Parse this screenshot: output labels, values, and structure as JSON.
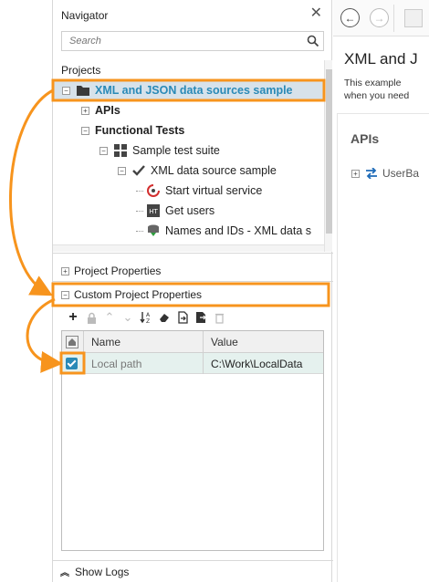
{
  "navigator": {
    "title": "Navigator",
    "search_placeholder": "Search",
    "projects_label": "Projects",
    "tree": [
      {
        "label": "XML and JSON data sources sample",
        "icon": "folder-icon",
        "expander": "−"
      },
      {
        "label": "APIs",
        "icon": "",
        "expander": "+"
      },
      {
        "label": "Functional Tests",
        "icon": "",
        "expander": "−"
      },
      {
        "label": "Sample test suite",
        "icon": "grid-icon",
        "expander": "−"
      },
      {
        "label": "XML data source sample",
        "icon": "checkmark-icon",
        "expander": "−"
      },
      {
        "label": "Start virtual service",
        "icon": "virtual-service-icon",
        "expander": ""
      },
      {
        "label": "Get users",
        "icon": "request-icon",
        "expander": ""
      },
      {
        "label": "Names and IDs - XML data s",
        "icon": "data-source-icon",
        "expander": ""
      }
    ],
    "project_properties_label": "Project Properties",
    "custom_properties_label": "Custom Project Properties",
    "grid": {
      "columns": [
        "Name",
        "Value"
      ],
      "rows": [
        {
          "checked": true,
          "name": "Local path",
          "value": "C:\\Work\\LocalData"
        }
      ]
    },
    "show_logs_label": "Show Logs"
  },
  "right_panel": {
    "title": "XML and J",
    "desc_line1": "This example",
    "desc_line2": "when you need",
    "section_title": "APIs",
    "api_item": "UserBa"
  },
  "colors": {
    "accent_orange": "#f7941d",
    "selection_text": "#2a8ab7",
    "check_blue": "#2a8ab7"
  }
}
